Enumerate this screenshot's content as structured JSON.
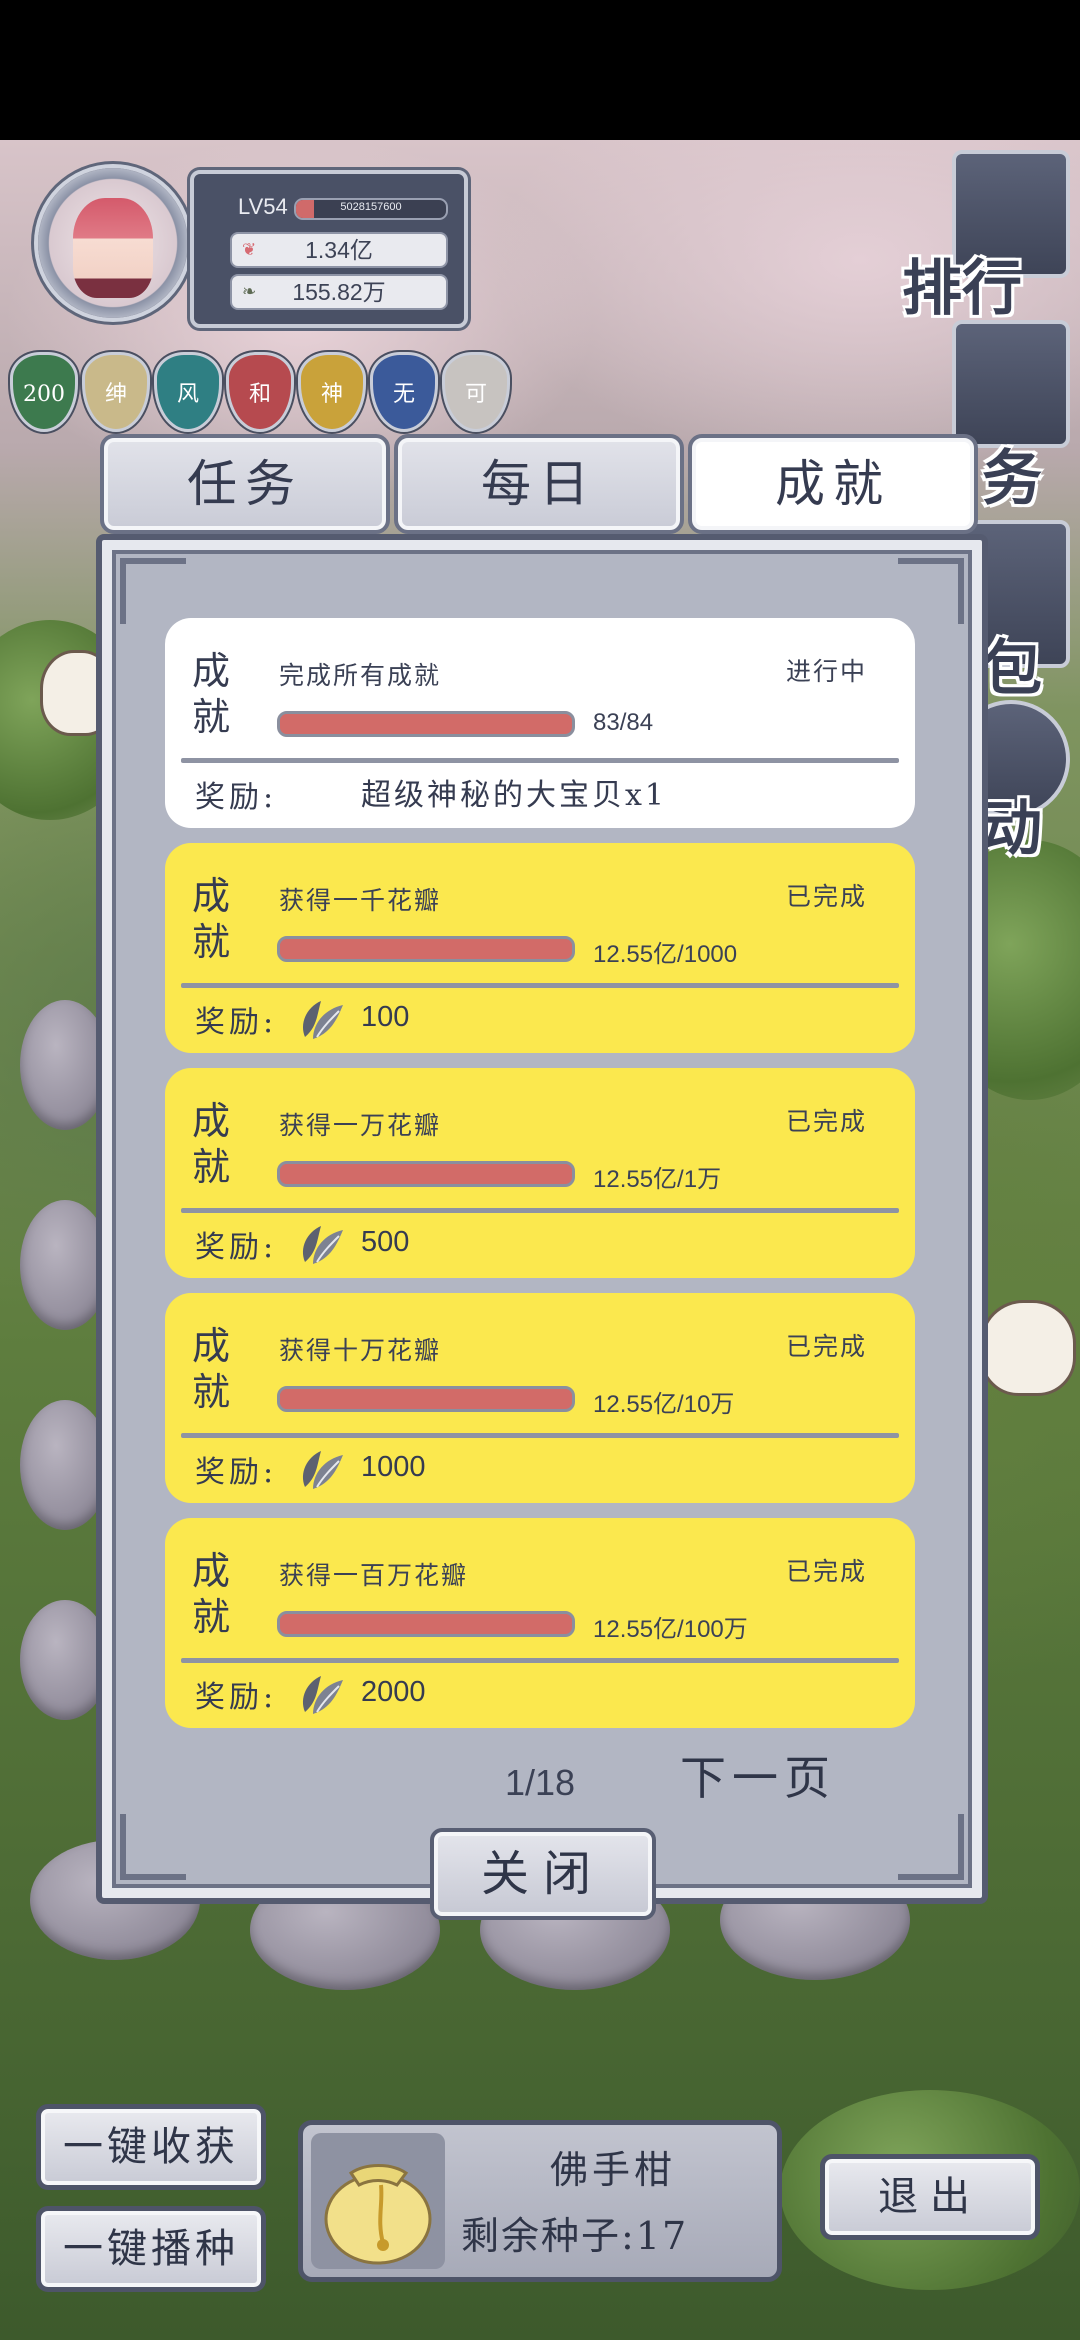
{
  "profile": {
    "level": "LV54",
    "exp_text": "5028157600",
    "exp_fraction": 0.12,
    "petals": "1.34亿",
    "seeds_total": "155.82万"
  },
  "badges": [
    {
      "label": "200",
      "color": "#3d7a4e"
    },
    {
      "label": "绅",
      "color": "#c9b98a"
    },
    {
      "label": "风",
      "color": "#2f7f83"
    },
    {
      "label": "和",
      "color": "#b64a4f"
    },
    {
      "label": "神",
      "color": "#c9a23a"
    },
    {
      "label": "无",
      "color": "#3b5a9a"
    },
    {
      "label": "可",
      "color": "#c7c3c0"
    }
  ],
  "side_menu": {
    "rank": "排行",
    "task": "务",
    "bag": "包",
    "event": "动"
  },
  "tabs": [
    {
      "label": "任务",
      "active": false
    },
    {
      "label": "每日",
      "active": false
    },
    {
      "label": "成就",
      "active": true
    }
  ],
  "achievements": [
    {
      "badge": "成就",
      "title": "完成所有成就",
      "status": "进行中",
      "progress_text": "83/84",
      "progress_fraction": 0.988,
      "reward_label": "奖励:",
      "reward_text": "超级神秘的大宝贝x1",
      "style": "white"
    },
    {
      "badge": "成就",
      "title": "获得一千花瓣",
      "status": "已完成",
      "progress_text": "12.55亿/1000",
      "progress_fraction": 1,
      "reward_label": "奖励:",
      "reward_icon": "petal-icon",
      "reward_value": "100",
      "style": "yellow"
    },
    {
      "badge": "成就",
      "title": "获得一万花瓣",
      "status": "已完成",
      "progress_text": "12.55亿/1万",
      "progress_fraction": 1,
      "reward_label": "奖励:",
      "reward_icon": "petal-icon",
      "reward_value": "500",
      "style": "yellow"
    },
    {
      "badge": "成就",
      "title": "获得十万花瓣",
      "status": "已完成",
      "progress_text": "12.55亿/10万",
      "progress_fraction": 1,
      "reward_label": "奖励:",
      "reward_icon": "petal-icon",
      "reward_value": "1000",
      "style": "yellow"
    },
    {
      "badge": "成就",
      "title": "获得一百万花瓣",
      "status": "已完成",
      "progress_text": "12.55亿/100万",
      "progress_fraction": 1,
      "reward_label": "奖励:",
      "reward_icon": "petal-icon",
      "reward_value": "2000",
      "style": "yellow"
    }
  ],
  "pager": {
    "count": "1/18",
    "next_label": "下一页"
  },
  "close_label": "关闭",
  "bottom": {
    "harvest_all": "一键收获",
    "sow_all": "一键播种",
    "seed_name": "佛手柑",
    "seed_remaining": "剩余种子:17",
    "exit": "退出"
  },
  "colors": {
    "card_done": "#fbe84e",
    "card_progress": "#ffffff",
    "progress_bar": "#d26b68",
    "frame": "#555b70"
  }
}
